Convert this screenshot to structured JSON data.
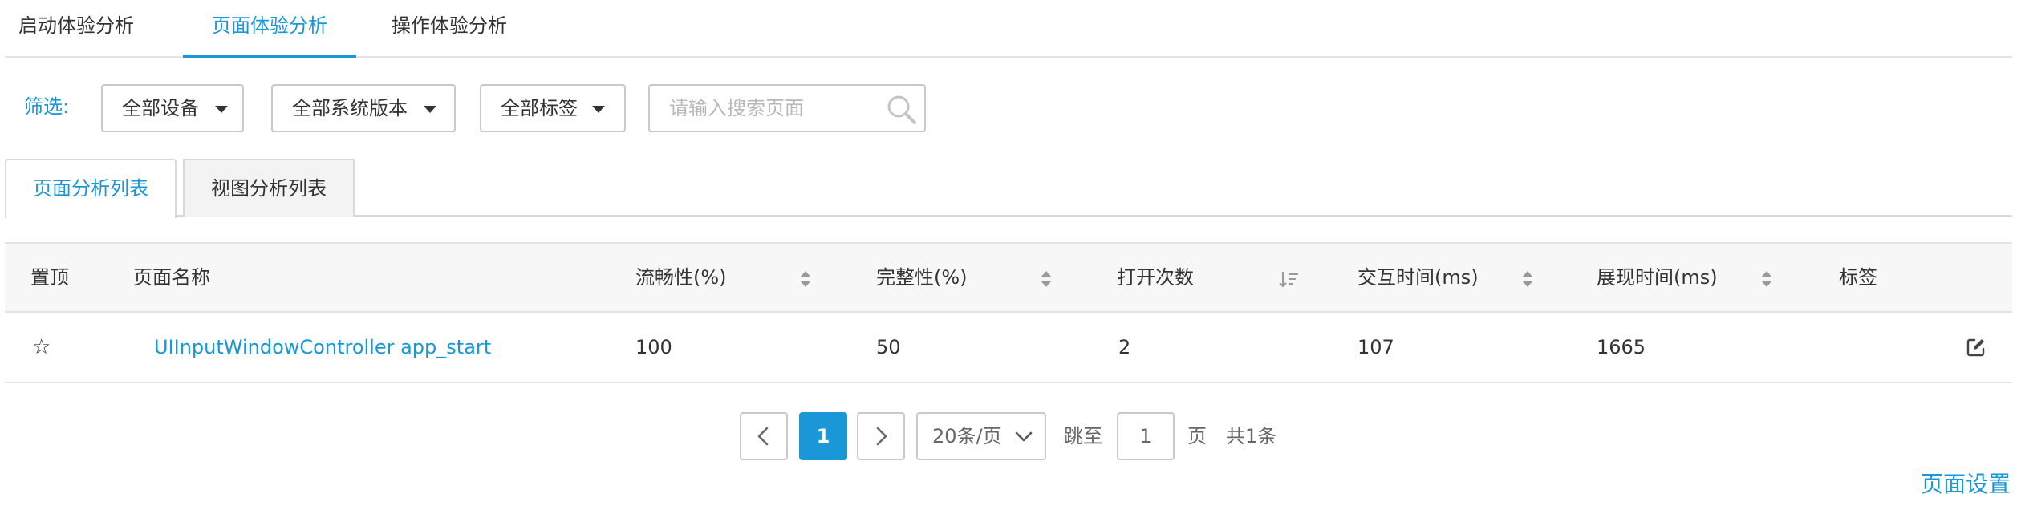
{
  "top_tabs": [
    {
      "label": "启动体验分析",
      "active": false
    },
    {
      "label": "页面体验分析",
      "active": true
    },
    {
      "label": "操作体验分析",
      "active": false
    }
  ],
  "filter": {
    "label": "筛选:",
    "device": "全部设备",
    "os_version": "全部系统版本",
    "tags": "全部标签",
    "search_placeholder": "请输入搜索页面",
    "search_value": ""
  },
  "sub_tabs": [
    {
      "label": "页面分析列表",
      "active": true
    },
    {
      "label": "视图分析列表",
      "active": false
    }
  ],
  "table": {
    "headers": [
      "置顶",
      "页面名称",
      "流畅性(%)",
      "完整性(%)",
      "打开次数",
      "交互时间(ms)",
      "展现时间(ms)",
      "标签"
    ],
    "rows": [
      {
        "pin": "☆",
        "page_name": "UIInputWindowController app_start",
        "smoothness": "100",
        "completeness": "50",
        "open_count": "2",
        "interaction_time": "107",
        "display_time": "1665",
        "tag": ""
      }
    ]
  },
  "pagination": {
    "current_page": "1",
    "page_size": "20条/页",
    "jump_label": "跳至",
    "jump_value": "1",
    "page_unit": "页",
    "total": "共1条"
  },
  "page_settings_link": "页面设置",
  "colors": {
    "accent": "#1a97d6",
    "border": "#c9c9c9",
    "header_bg": "#f7f7f7"
  }
}
